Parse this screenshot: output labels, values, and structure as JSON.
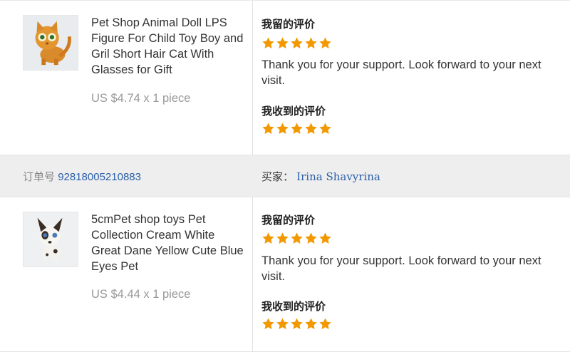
{
  "orders": [
    {
      "product": {
        "title": "Pet Shop Animal Doll LPS Figure For Child Toy Boy and Gril Short Hair Cat With Glasses for Gift",
        "price": "US $4.74 x 1 piece",
        "image_icon": "orange-cat-figure"
      },
      "my_review": {
        "label": "我留的评价",
        "stars": 5,
        "text": "Thank you for your support. Look forward to your next visit."
      },
      "received_review": {
        "label": "我收到的评价",
        "stars": 5
      }
    },
    {
      "order_label": "订单号",
      "order_number": "92818005210883",
      "buyer_label": "买家：",
      "buyer_name": "Irina Shavyrina",
      "product": {
        "title": "5cmPet shop toys Pet Collection Cream White Great Dane Yellow Cute Blue Eyes Pet",
        "price": "US $4.44 x 1 piece",
        "image_icon": "great-dane-dog-figure"
      },
      "my_review": {
        "label": "我留的评价",
        "stars": 5,
        "text": "Thank you for your support. Look forward to your next visit."
      },
      "received_review": {
        "label": "我收到的评价",
        "stars": 5
      }
    }
  ],
  "colors": {
    "star": "#f39800",
    "link": "#2a5fa8",
    "order_bar": "#eeeeee"
  }
}
